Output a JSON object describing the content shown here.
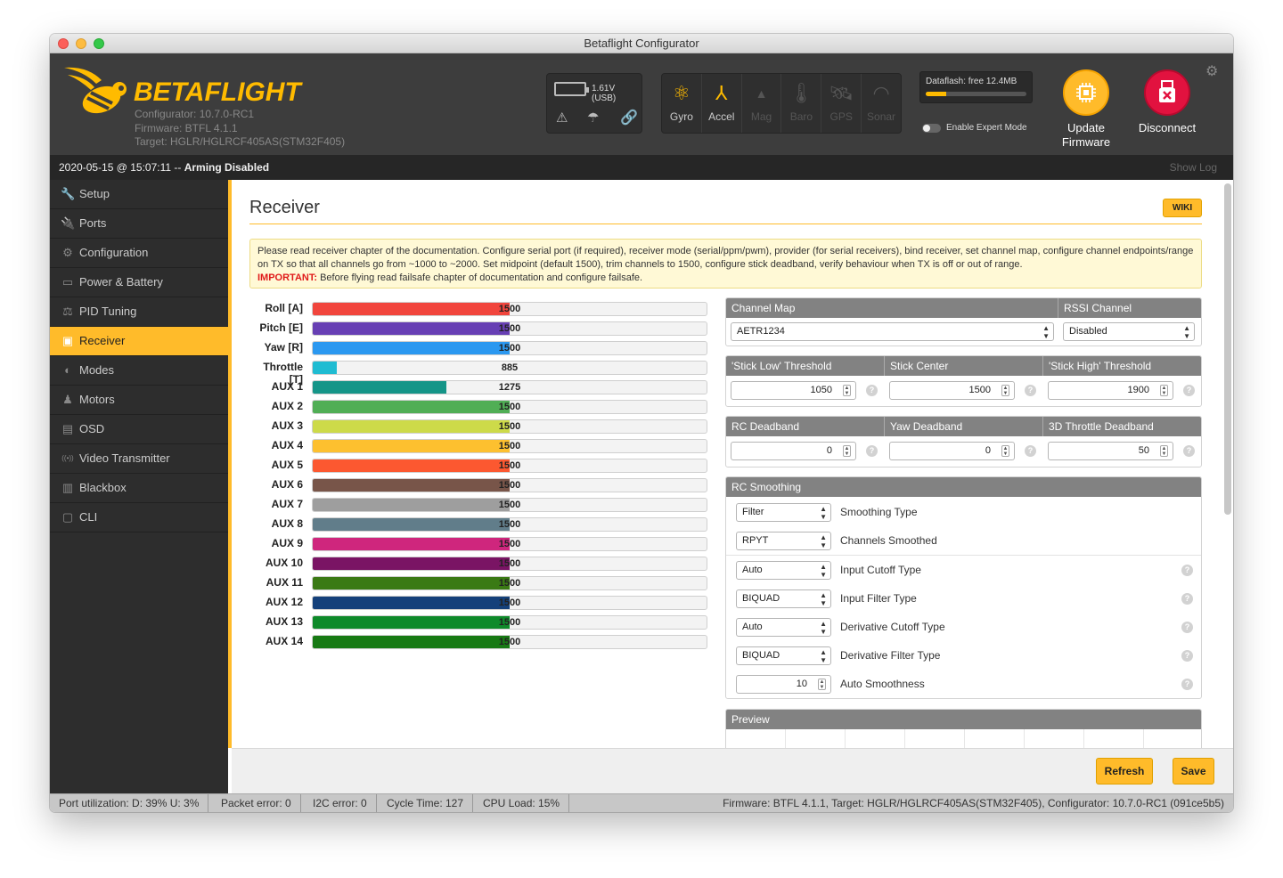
{
  "window": {
    "title": "Betaflight Configurator"
  },
  "header": {
    "logo": "BETAFLIGHT",
    "configurator": "Configurator: 10.7.0-RC1",
    "firmware": "Firmware: BTFL 4.1.1",
    "target": "Target: HGLR/HGLRCF405AS(STM32F405)",
    "battery": "1.61V (USB)",
    "sensors": [
      {
        "label": "Gyro",
        "icon": "gyro-icon",
        "active": true
      },
      {
        "label": "Accel",
        "icon": "accel-icon",
        "active": true
      },
      {
        "label": "Mag",
        "icon": "mag-icon",
        "active": false
      },
      {
        "label": "Baro",
        "icon": "baro-icon",
        "active": false
      },
      {
        "label": "GPS",
        "icon": "gps-icon",
        "active": false
      },
      {
        "label": "Sonar",
        "icon": "sonar-icon",
        "active": false
      }
    ],
    "dataflash": "Dataflash: free 12.4MB",
    "dataflash_used": 0.2,
    "expert_mode": "Enable Expert Mode",
    "update_firmware_l1": "Update",
    "update_firmware_l2": "Firmware",
    "disconnect": "Disconnect"
  },
  "logbar": {
    "date": "2020-05-15 @ 15:07:11 -- ",
    "status": "Arming Disabled",
    "show_log": "Show Log"
  },
  "sidebar": {
    "items": [
      {
        "label": "Setup",
        "icon": "wrench-icon",
        "glyph": "🔧"
      },
      {
        "label": "Ports",
        "icon": "plug-icon",
        "glyph": "🔌"
      },
      {
        "label": "Configuration",
        "icon": "gear-icon",
        "glyph": "⚙"
      },
      {
        "label": "Power & Battery",
        "icon": "battery-icon",
        "glyph": "▭"
      },
      {
        "label": "PID Tuning",
        "icon": "pid-icon",
        "glyph": "⚖"
      },
      {
        "label": "Receiver",
        "icon": "receiver-icon",
        "glyph": "▣"
      },
      {
        "label": "Modes",
        "icon": "modes-icon",
        "glyph": "◐"
      },
      {
        "label": "Motors",
        "icon": "motor-icon",
        "glyph": "♟"
      },
      {
        "label": "OSD",
        "icon": "osd-icon",
        "glyph": "▤"
      },
      {
        "label": "Video Transmitter",
        "icon": "vtx-icon",
        "glyph": "((•))"
      },
      {
        "label": "Blackbox",
        "icon": "blackbox-icon",
        "glyph": "▥"
      },
      {
        "label": "CLI",
        "icon": "cli-icon",
        "glyph": "▢"
      }
    ],
    "active_index": 5
  },
  "page": {
    "title": "Receiver",
    "wiki": "WIKI",
    "note_text": "Please read receiver chapter of the documentation. Configure serial port (if required), receiver mode (serial/ppm/pwm), provider (for serial receivers), bind receiver, set channel map, configure channel endpoints/range on TX so that all channels go from ~1000 to ~2000. Set midpoint (default 1500), trim channels to 1500, configure stick deadband, verify behaviour when TX is off or out of range.",
    "note_important": "IMPORTANT:",
    "note_important_text": " Before flying read failsafe chapter of documentation and configure failsafe."
  },
  "channels": [
    {
      "name": "Roll [A]",
      "value": "1500",
      "fraction": 0.5,
      "color": "#f1453d"
    },
    {
      "name": "Pitch [E]",
      "value": "1500",
      "fraction": 0.5,
      "color": "#673fb4"
    },
    {
      "name": "Yaw [R]",
      "value": "1500",
      "fraction": 0.5,
      "color": "#2b98f0"
    },
    {
      "name": "Throttle [T]",
      "value": "885",
      "fraction": 0.06,
      "color": "#1fbcd2"
    },
    {
      "name": "AUX 1",
      "value": "1275",
      "fraction": 0.34,
      "color": "#159588"
    },
    {
      "name": "AUX 2",
      "value": "1500",
      "fraction": 0.5,
      "color": "#50ae55"
    },
    {
      "name": "AUX 3",
      "value": "1500",
      "fraction": 0.5,
      "color": "#cdda49"
    },
    {
      "name": "AUX 4",
      "value": "1500",
      "fraction": 0.5,
      "color": "#fdc02f"
    },
    {
      "name": "AUX 5",
      "value": "1500",
      "fraction": 0.5,
      "color": "#fc5830"
    },
    {
      "name": "AUX 6",
      "value": "1500",
      "fraction": 0.5,
      "color": "#785549"
    },
    {
      "name": "AUX 7",
      "value": "1500",
      "fraction": 0.5,
      "color": "#9e9e9e"
    },
    {
      "name": "AUX 8",
      "value": "1500",
      "fraction": 0.5,
      "color": "#617d8a"
    },
    {
      "name": "AUX 9",
      "value": "1500",
      "fraction": 0.5,
      "color": "#cf267d"
    },
    {
      "name": "AUX 10",
      "value": "1500",
      "fraction": 0.5,
      "color": "#7a1464"
    },
    {
      "name": "AUX 11",
      "value": "1500",
      "fraction": 0.5,
      "color": "#3a7a14"
    },
    {
      "name": "AUX 12",
      "value": "1500",
      "fraction": 0.5,
      "color": "#14407a"
    },
    {
      "name": "AUX 13",
      "value": "1500",
      "fraction": 0.5,
      "color": "#0e8a2a"
    },
    {
      "name": "AUX 14",
      "value": "1500",
      "fraction": 0.5,
      "color": "#177a14"
    }
  ],
  "channel_map": {
    "header": "Channel Map",
    "value": "AETR1234"
  },
  "rssi": {
    "header": "RSSI Channel",
    "value": "Disabled"
  },
  "thresholds": {
    "h1": "'Stick Low' Threshold",
    "v1": "1050",
    "h2": "Stick Center",
    "v2": "1500",
    "h3": "'Stick High' Threshold",
    "v3": "1900"
  },
  "deadbands": {
    "h1": "RC Deadband",
    "v1": "0",
    "h2": "Yaw Deadband",
    "v2": "0",
    "h3": "3D Throttle Deadband",
    "v3": "50"
  },
  "smoothing": {
    "header": "RC Smoothing",
    "rows": [
      {
        "value": "Filter",
        "label": "Smoothing Type"
      },
      {
        "value": "RPYT",
        "label": "Channels Smoothed"
      },
      {
        "value": "Auto",
        "label": "Input Cutoff Type"
      },
      {
        "value": "BIQUAD",
        "label": "Input Filter Type"
      },
      {
        "value": "Auto",
        "label": "Derivative Cutoff Type"
      },
      {
        "value": "BIQUAD",
        "label": "Derivative Filter Type"
      },
      {
        "value": "10",
        "label": "Auto Smoothness"
      }
    ]
  },
  "preview": {
    "header": "Preview"
  },
  "buttons": {
    "refresh": "Refresh",
    "save": "Save"
  },
  "statusbar": {
    "port": "Port utilization: D: 39% U: 3%",
    "packet": "Packet error: 0",
    "i2c": "I2C error: 0",
    "cycle": "Cycle Time: 127",
    "cpu": "CPU Load: 15%",
    "fw": "Firmware: BTFL 4.1.1, Target: HGLR/HGLRCF405AS(STM32F405), Configurator: 10.7.0-RC1 (091ce5b5)"
  }
}
